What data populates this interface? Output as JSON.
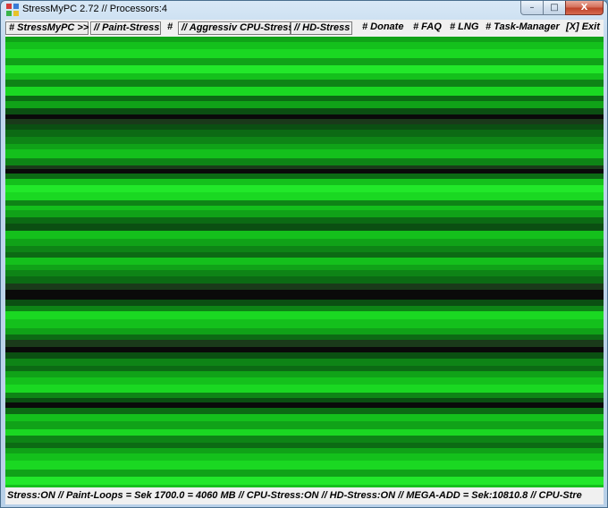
{
  "window": {
    "title": "StressMyPC 2.72 // Processors:4",
    "controls": {
      "minimize": "–",
      "maximize": "□",
      "close": "X"
    }
  },
  "menu": {
    "items": [
      {
        "id": "stressmypc",
        "label": "# StressMyPC >>",
        "boxed": true
      },
      {
        "id": "paint-stress",
        "label": "// Paint-Stress",
        "boxed": true
      },
      {
        "id": "hash-separator",
        "label": "#",
        "boxed": false
      },
      {
        "id": "aggressiv-cpu-stress",
        "label": "// Aggressiv CPU-Stress",
        "boxed": true
      },
      {
        "id": "hd-stress",
        "label": "// HD-Stress",
        "boxed": true
      },
      {
        "id": "donate",
        "label": "# Donate",
        "boxed": false
      },
      {
        "id": "faq",
        "label": "# FAQ",
        "boxed": false
      },
      {
        "id": "lng",
        "label": "# LNG",
        "boxed": false
      },
      {
        "id": "task-manager",
        "label": "# Task-Manager",
        "boxed": false
      },
      {
        "id": "exit",
        "label": "[X] Exit",
        "boxed": false
      }
    ]
  },
  "status": {
    "text": "Stress:ON // Paint-Loops = Sek 1700.0 = 4060 MB // CPU-Stress:ON // HD-Stress:ON // MEGA-ADD = Sek:10810.8 // CPU-Stre"
  },
  "colors": {
    "stripe_palette": [
      "#0a0a0a",
      "#1a3a1a",
      "#0b4f12",
      "#0c6a14",
      "#0e8416",
      "#10a218",
      "#14c01c",
      "#1ad822",
      "#22e82a"
    ],
    "menu_bg": "#f0f0f0",
    "title_gradient_top": "#d8e8f6"
  },
  "icons": {
    "app": "stressmypc-app-icon",
    "minimize": "minimize-icon",
    "maximize": "maximize-icon",
    "close": "close-icon"
  }
}
